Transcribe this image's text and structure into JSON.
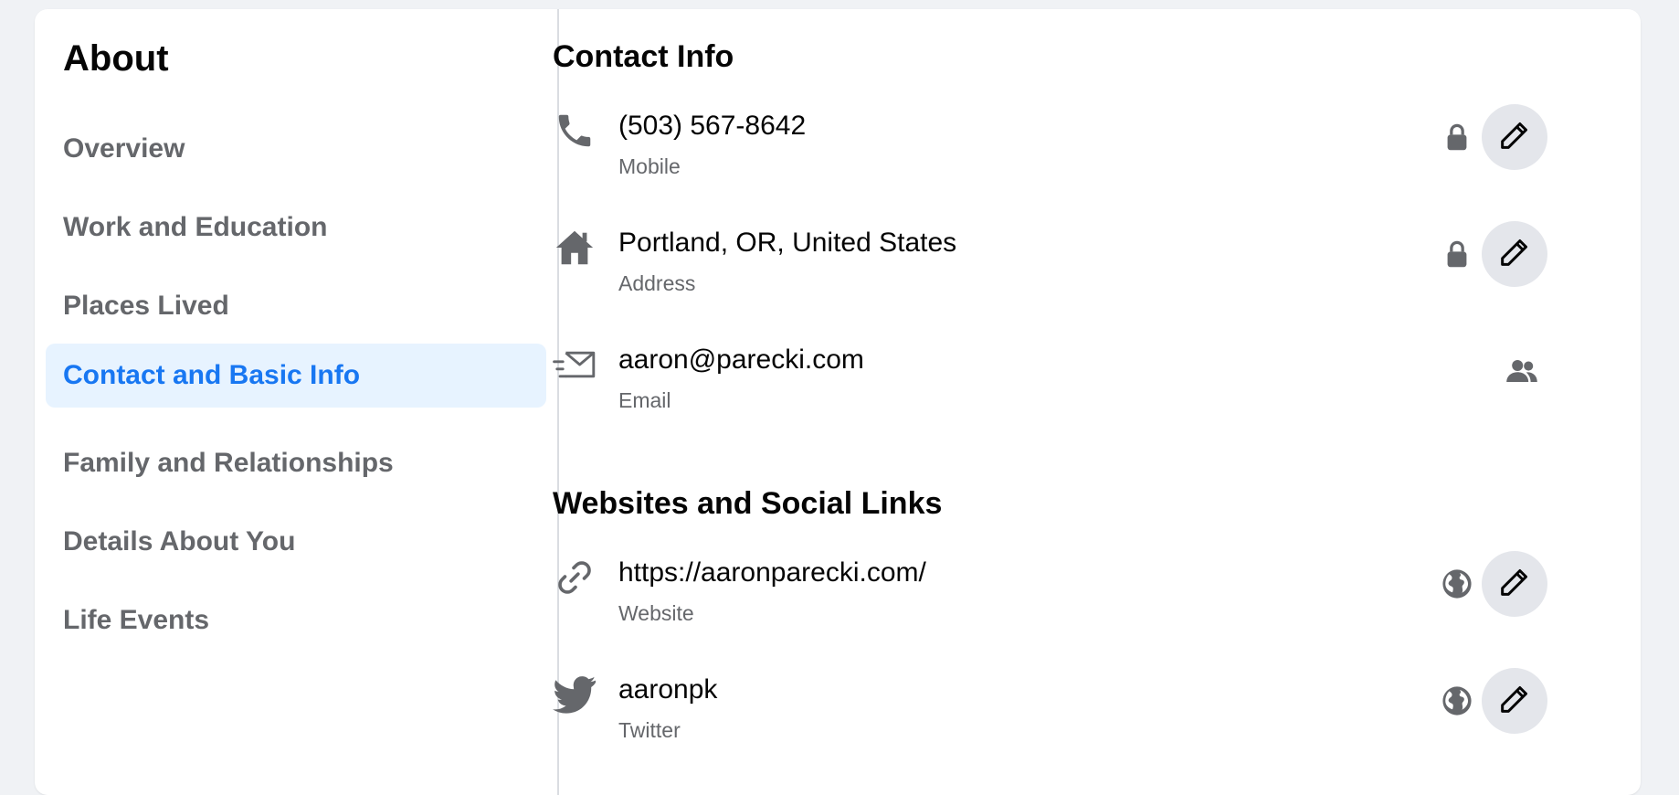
{
  "sidebar": {
    "title": "About",
    "items": [
      {
        "label": "Overview"
      },
      {
        "label": "Work and Education"
      },
      {
        "label": "Places Lived"
      },
      {
        "label": "Contact and Basic Info",
        "active": true
      },
      {
        "label": "Family and Relationships"
      },
      {
        "label": "Details About You"
      },
      {
        "label": "Life Events"
      }
    ]
  },
  "contact": {
    "title": "Contact Info",
    "rows": [
      {
        "value": "(503) 567-8642",
        "label": "Mobile",
        "icon": "phone-icon",
        "privacy": "lock-icon",
        "editable": true
      },
      {
        "value": "Portland, OR, United States",
        "label": "Address",
        "icon": "home-icon",
        "privacy": "lock-icon",
        "editable": true
      },
      {
        "value": "aaron@parecki.com",
        "label": "Email",
        "icon": "email-icon",
        "privacy": "friends-icon",
        "editable": false
      }
    ]
  },
  "websites": {
    "title": "Websites and Social Links",
    "rows": [
      {
        "value": "https://aaronparecki.com/",
        "label": "Website",
        "icon": "link-icon",
        "privacy": "globe-icon",
        "editable": true
      },
      {
        "value": "aaronpk",
        "label": "Twitter",
        "icon": "twitter-icon",
        "privacy": "globe-icon",
        "editable": true
      }
    ]
  },
  "colors": {
    "accent": "#1877f2",
    "active_bg": "#e7f3ff",
    "icon_gray": "#65676b",
    "button_bg": "#e4e6eb"
  }
}
